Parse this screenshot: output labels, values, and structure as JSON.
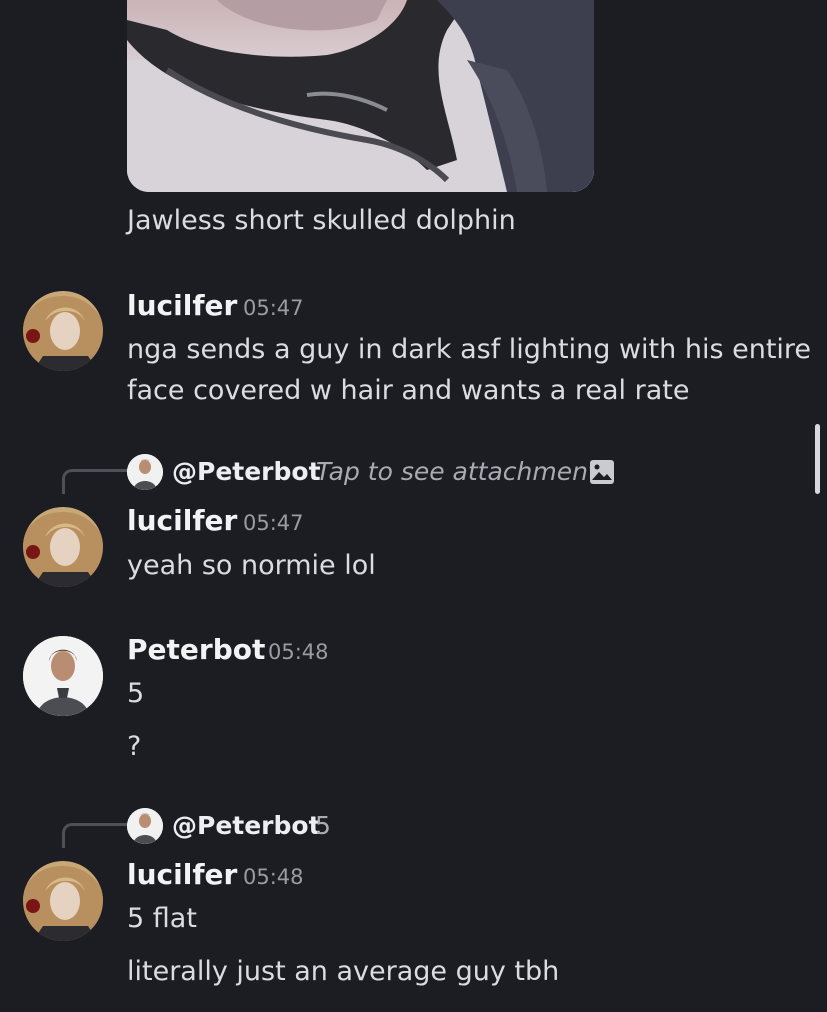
{
  "attachment": {
    "caption": "Jawless short skulled dolphin"
  },
  "messages": [
    {
      "author": "lucilfer",
      "time": "05:47",
      "lines": [
        "nga sends a guy in dark asf lighting with his entire",
        "face covered w hair and wants a real rate"
      ]
    },
    {
      "reply": {
        "mention": "@Peterbot",
        "text": "Tap to see attachment",
        "icon": "image-icon"
      },
      "author": "lucilfer",
      "time": "05:47",
      "lines": [
        "yeah so normie lol"
      ]
    },
    {
      "author": "Peterbot",
      "time": "05:48",
      "lines": [
        "5",
        "?"
      ]
    },
    {
      "reply": {
        "mention": "@Peterbot",
        "text": "5"
      },
      "author": "lucilfer",
      "time": "05:48",
      "lines": [
        "5 flat",
        "literally just an average guy tbh"
      ]
    }
  ],
  "colors": {
    "background": "#1c1d22",
    "username": "#f2f3f5",
    "timestamp": "#9a9ba3",
    "message": "#dbdce0"
  }
}
